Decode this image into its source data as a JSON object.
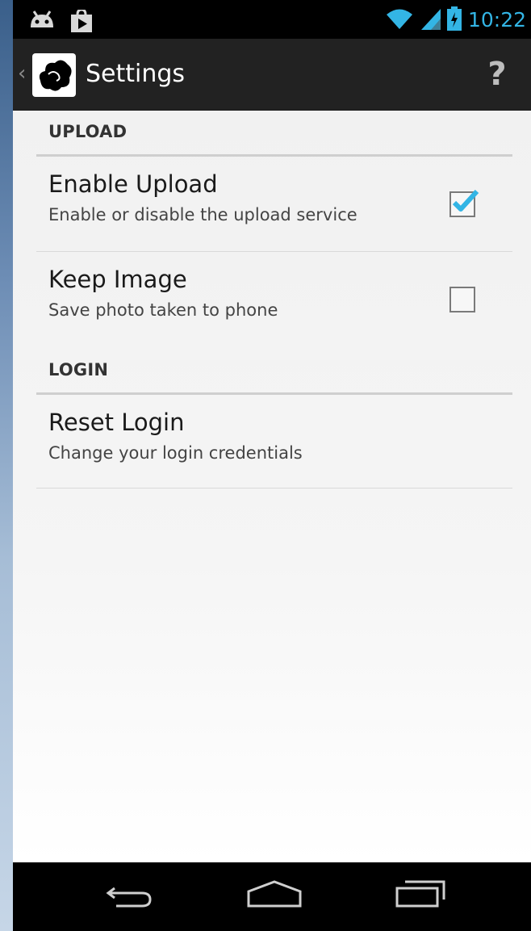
{
  "status_bar": {
    "time": "10:22",
    "icons": [
      "android-debug-icon",
      "play-store-icon",
      "wifi-icon",
      "signal-icon",
      "battery-charging-icon"
    ]
  },
  "action_bar": {
    "title": "Settings",
    "up_icon": "chevron-left-icon",
    "app_icon": "app-logo-icon",
    "help_label": "?"
  },
  "sections": [
    {
      "header": "UPLOAD",
      "items": [
        {
          "title": "Enable Upload",
          "summary": "Enable or disable the upload service",
          "checked": true
        },
        {
          "title": "Keep Image",
          "summary": "Save photo taken to phone",
          "checked": false
        }
      ]
    },
    {
      "header": "LOGIN",
      "items": [
        {
          "title": "Reset Login",
          "summary": "Change your login credentials"
        }
      ]
    }
  ],
  "nav_bar": {
    "buttons": [
      "back-icon",
      "home-icon",
      "recent-apps-icon"
    ]
  },
  "colors": {
    "accent": "#33b5e5",
    "action_bar_bg": "#222222",
    "content_bg": "#f1f1f1",
    "checkmark": "#33b5e5"
  }
}
